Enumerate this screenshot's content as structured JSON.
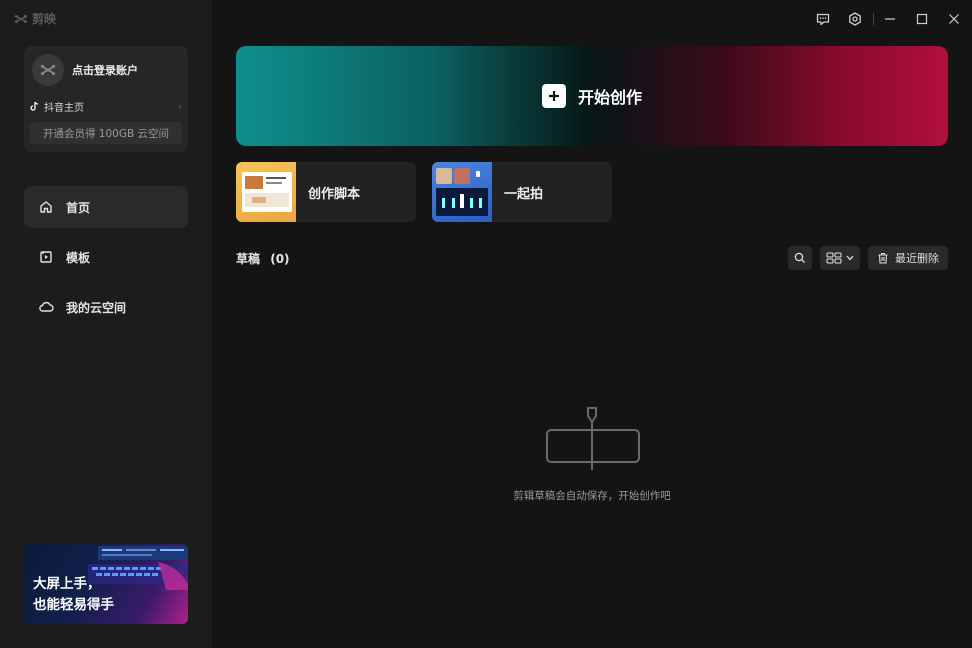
{
  "app": {
    "name": "剪映"
  },
  "account": {
    "login_label": "点击登录账户",
    "douyin_label": "抖音主页",
    "vip_label": "开通会员得 100GB 云空间"
  },
  "sidebar": {
    "items": [
      {
        "label": "首页",
        "icon": "home-icon",
        "active": true
      },
      {
        "label": "模板",
        "icon": "template-icon",
        "active": false
      },
      {
        "label": "我的云空间",
        "icon": "cloud-icon",
        "active": false
      }
    ],
    "promo": {
      "line1": "大屏上手，",
      "line2": "也能轻易得手"
    }
  },
  "titlebar": {
    "controls": [
      "feedback-icon",
      "settings-icon",
      "minimize-icon",
      "maximize-icon",
      "close-icon"
    ]
  },
  "main": {
    "hero_label": "开始创作",
    "quick_actions": [
      {
        "label": "创作脚本",
        "icon": "script-thumbnail"
      },
      {
        "label": "一起拍",
        "icon": "shoot-together-thumbnail"
      }
    ],
    "drafts": {
      "title": "草稿",
      "count": "(0)",
      "recent_delete_label": "最近删除",
      "empty_text": "剪辑草稿会自动保存，开始创作吧"
    }
  },
  "colors": {
    "hero_start": "#0e8f8f",
    "hero_end": "#b0103a",
    "sidebar_bg": "#1c1c1c",
    "main_bg": "#141414"
  }
}
